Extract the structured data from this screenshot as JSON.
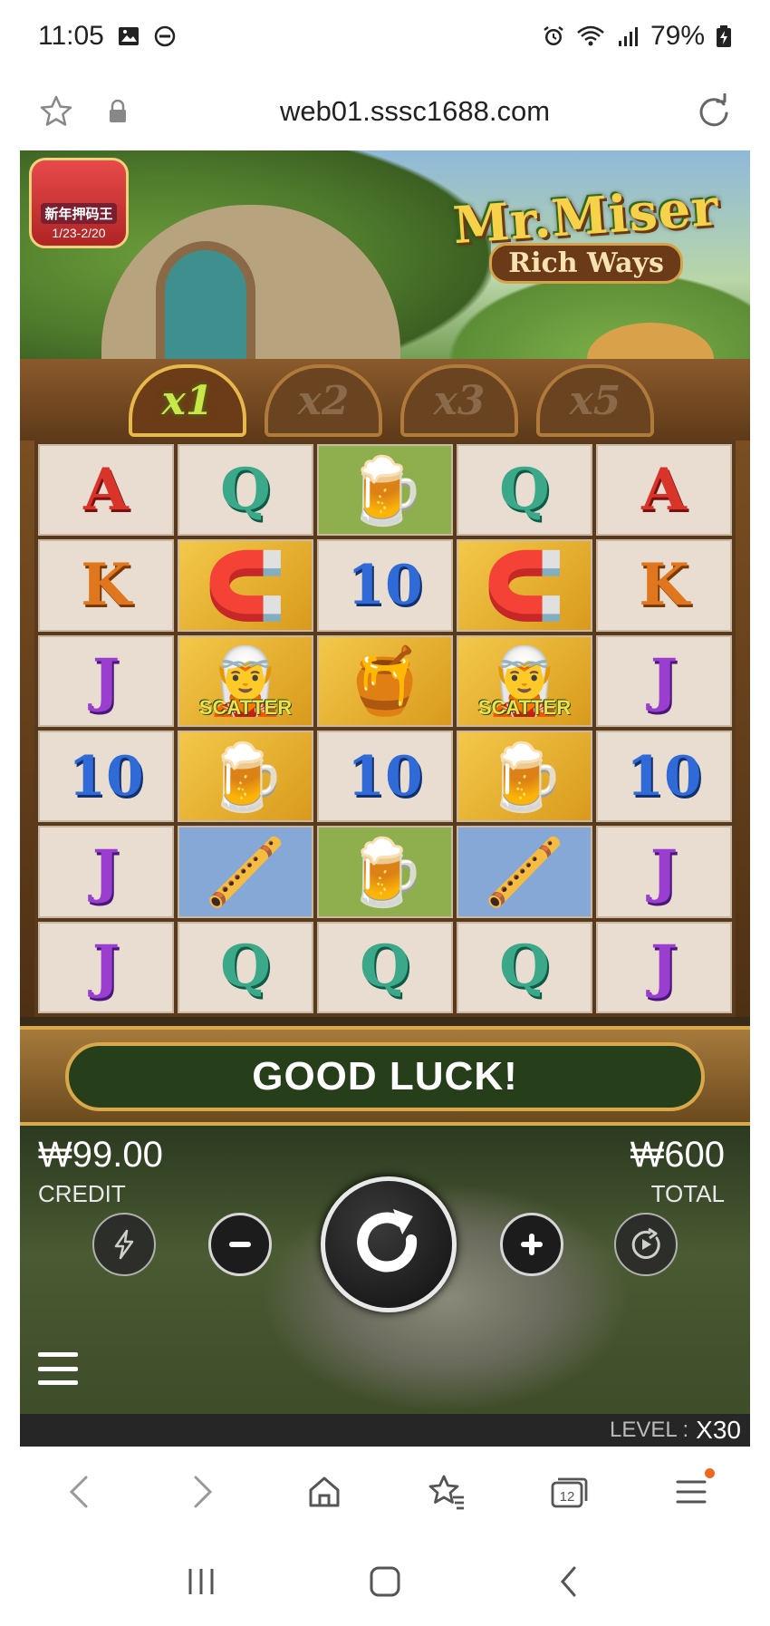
{
  "status_bar": {
    "time": "11:05",
    "battery": "79%"
  },
  "browser": {
    "url": "web01.sssc1688.com"
  },
  "game": {
    "promo": {
      "title": "新年押码王",
      "dates": "1/23-2/20"
    },
    "logo": {
      "line1": "Mr.Miser",
      "line2": "Rich Ways"
    },
    "multipliers": [
      "x1",
      "x2",
      "x3",
      "x5"
    ],
    "active_multiplier": "x1",
    "grid": [
      [
        {
          "s": "A",
          "t": "letter"
        },
        {
          "s": "Q",
          "t": "letter"
        },
        {
          "s": "beer-mug",
          "t": "pic",
          "bg": "green"
        },
        {
          "s": "Q",
          "t": "letter"
        },
        {
          "s": "A",
          "t": "letter"
        }
      ],
      [
        {
          "s": "K",
          "t": "letter"
        },
        {
          "s": "horseshoe",
          "t": "pic",
          "bg": "gold"
        },
        {
          "s": "10",
          "t": "letter"
        },
        {
          "s": "horseshoe",
          "t": "pic",
          "bg": "gold"
        },
        {
          "s": "K",
          "t": "letter"
        }
      ],
      [
        {
          "s": "J",
          "t": "letter"
        },
        {
          "s": "leprechaun",
          "t": "scatter",
          "bg": "gold"
        },
        {
          "s": "pot-of-gold",
          "t": "pic",
          "bg": "gold"
        },
        {
          "s": "leprechaun",
          "t": "scatter",
          "bg": "gold"
        },
        {
          "s": "J",
          "t": "letter"
        }
      ],
      [
        {
          "s": "10",
          "t": "letter"
        },
        {
          "s": "beer-mug",
          "t": "pic",
          "bg": "gold"
        },
        {
          "s": "10",
          "t": "letter"
        },
        {
          "s": "beer-mug",
          "t": "pic",
          "bg": "gold"
        },
        {
          "s": "10",
          "t": "letter"
        }
      ],
      [
        {
          "s": "J",
          "t": "letter"
        },
        {
          "s": "pipe",
          "t": "pic",
          "bg": "blue"
        },
        {
          "s": "beer-mug",
          "t": "pic",
          "bg": "green"
        },
        {
          "s": "pipe",
          "t": "pic",
          "bg": "blue"
        },
        {
          "s": "J",
          "t": "letter"
        }
      ],
      [
        {
          "s": "J",
          "t": "letter"
        },
        {
          "s": "Q",
          "t": "letter"
        },
        {
          "s": "Q",
          "t": "letter"
        },
        {
          "s": "Q",
          "t": "letter"
        },
        {
          "s": "J",
          "t": "letter"
        }
      ]
    ],
    "scatter_label": "SCATTER",
    "message": "GOOD LUCK!",
    "credit_value": "₩99.00",
    "credit_label": "CREDIT",
    "total_value": "₩600",
    "total_label": "TOTAL",
    "level_label": "LEVEL :",
    "level_value": "X30"
  },
  "nav": {
    "tabs_count": "12"
  }
}
